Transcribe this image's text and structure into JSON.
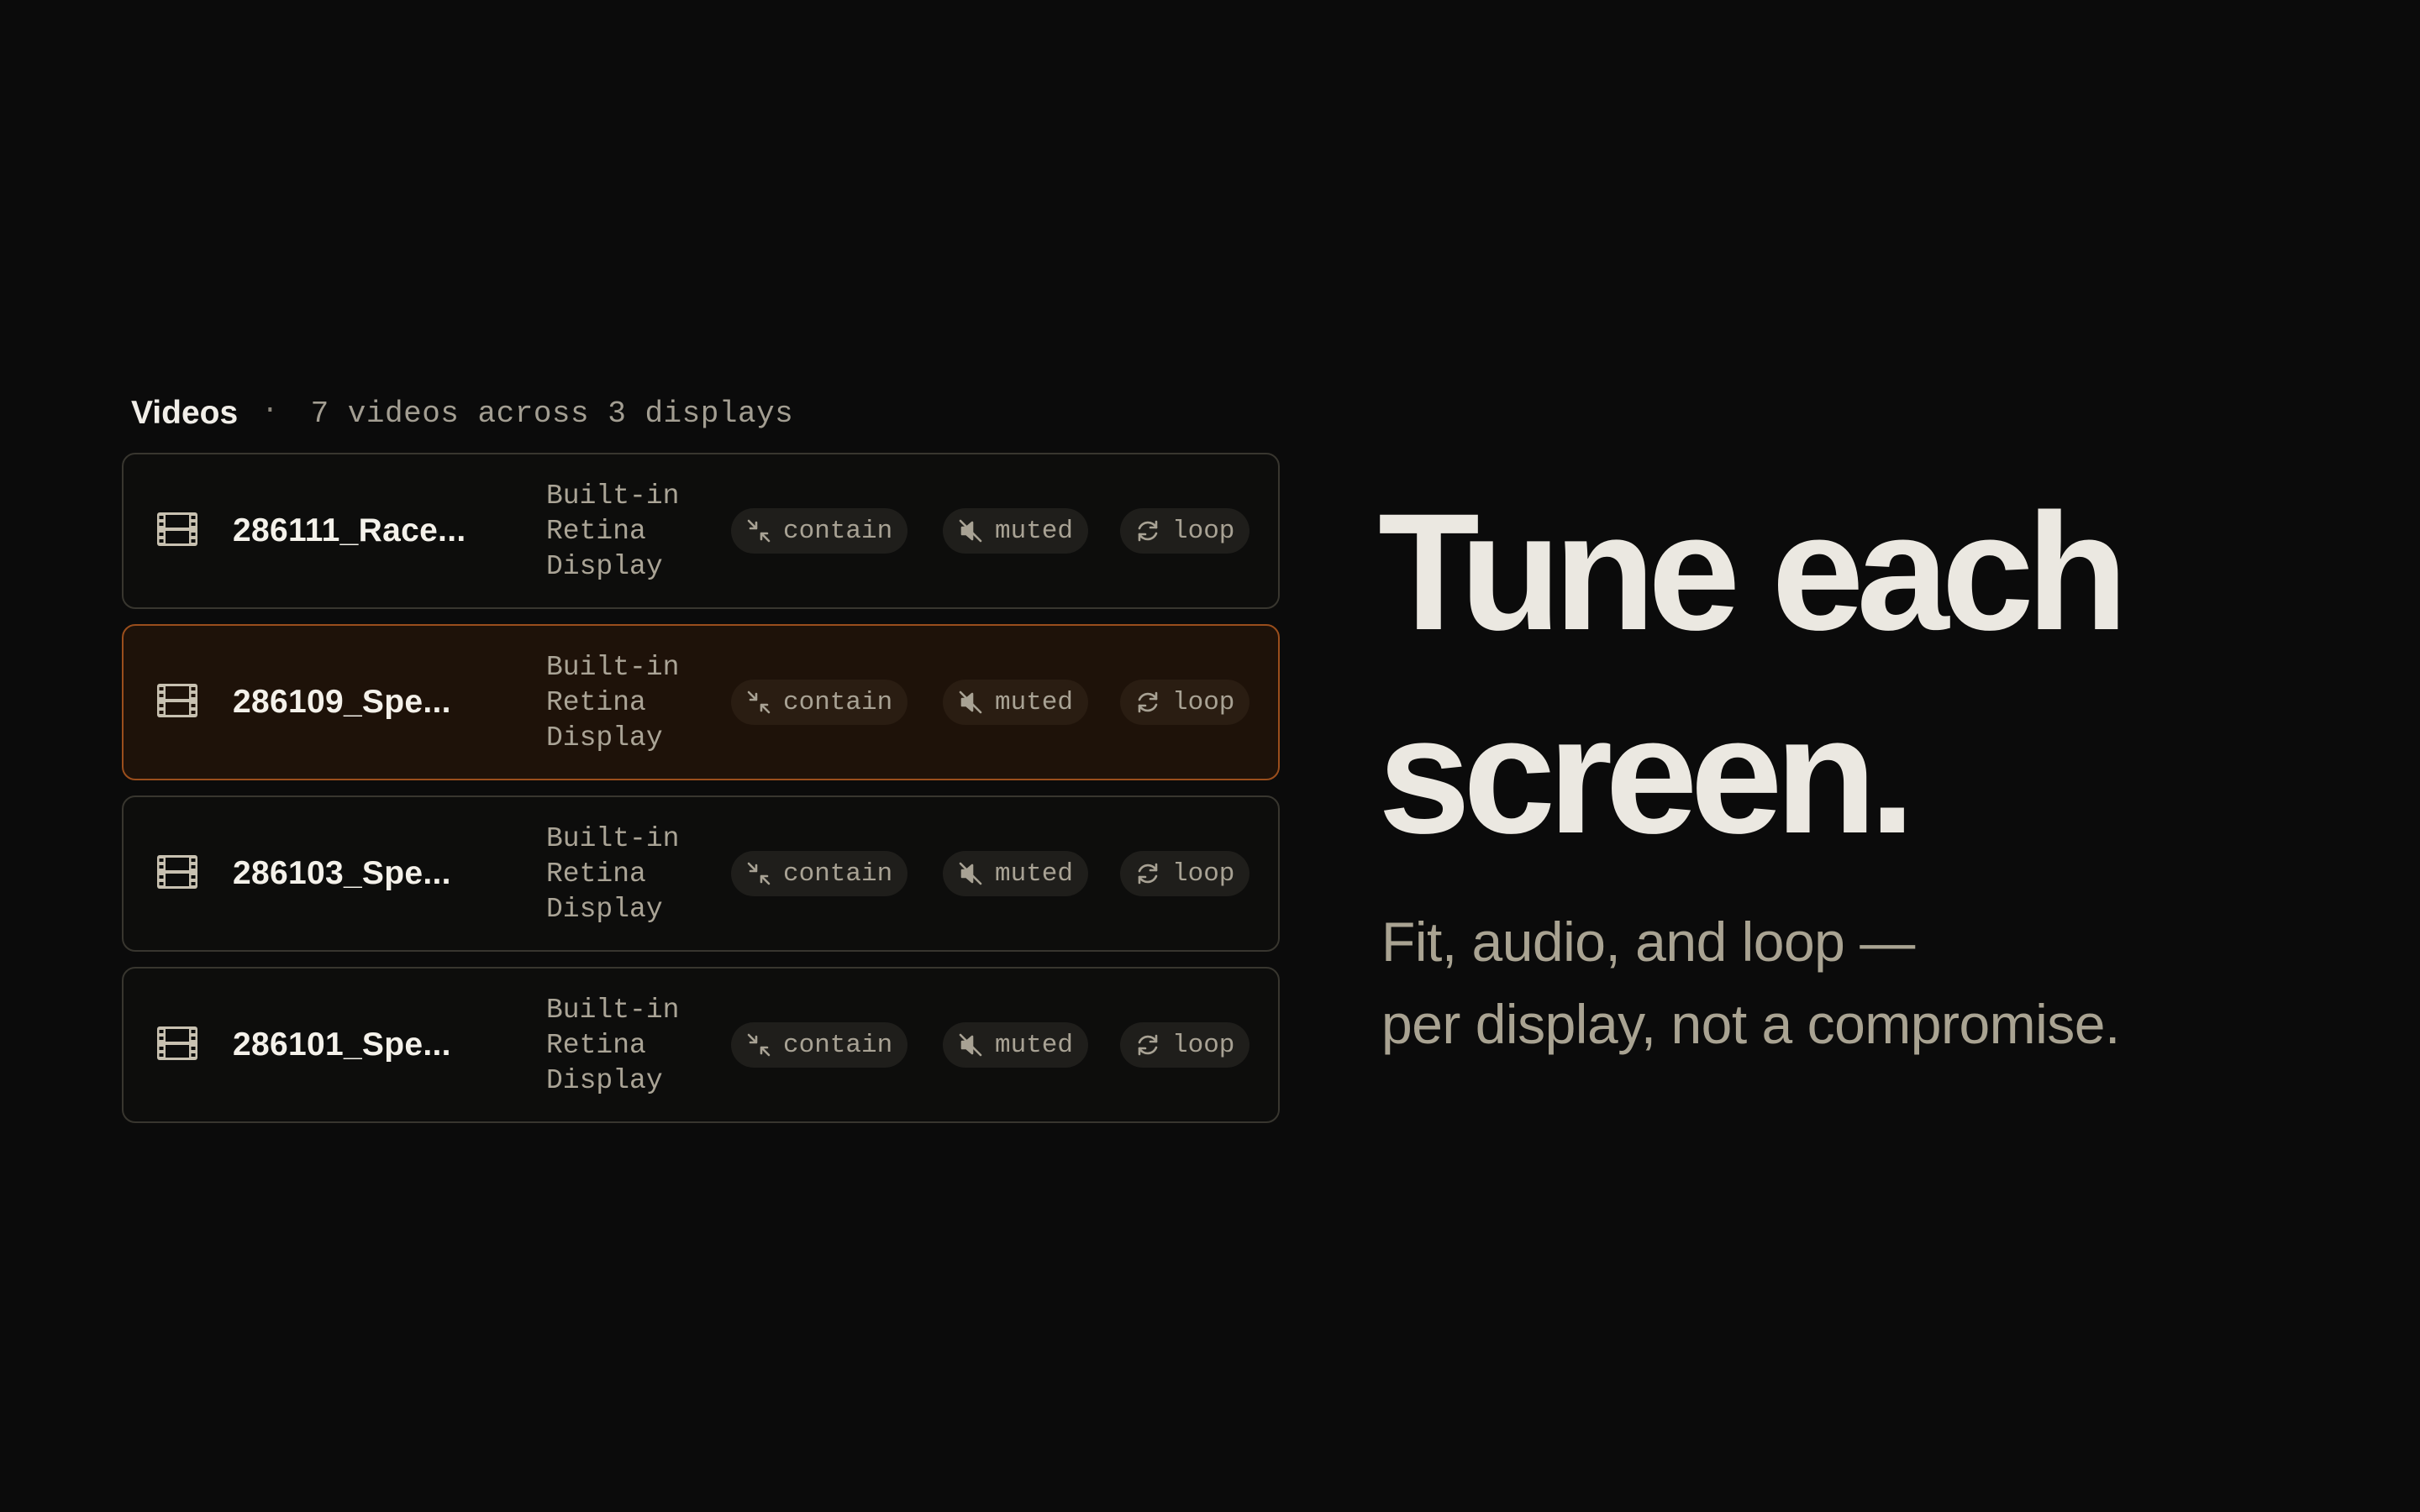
{
  "panel": {
    "title": "Videos",
    "separator": "·",
    "subtitle": "7 videos across 3 displays"
  },
  "videos": [
    {
      "name": "286111_Race...",
      "display_lines": [
        "Built-in",
        "Retina",
        "Display"
      ],
      "fit": "contain",
      "audio": "muted",
      "playback": "loop",
      "selected": false
    },
    {
      "name": "286109_Spe...",
      "display_lines": [
        "Built-in",
        "Retina",
        "Display"
      ],
      "fit": "contain",
      "audio": "muted",
      "playback": "loop",
      "selected": true
    },
    {
      "name": "286103_Spe...",
      "display_lines": [
        "Built-in",
        "Retina",
        "Display"
      ],
      "fit": "contain",
      "audio": "muted",
      "playback": "loop",
      "selected": false
    },
    {
      "name": "286101_Spe...",
      "display_lines": [
        "Built-in",
        "Retina",
        "Display"
      ],
      "fit": "contain",
      "audio": "muted",
      "playback": "loop",
      "selected": false
    }
  ],
  "icons": {
    "video": "film-icon",
    "fit": "contain-arrows-icon",
    "audio": "speaker-muted-icon",
    "playback": "loop-arrows-icon"
  },
  "hero": {
    "lines": [
      "Tune each",
      "screen."
    ]
  },
  "tagline": {
    "lines": [
      "Fit, audio, and loop —",
      "per display, not a compromise."
    ]
  },
  "colors": {
    "background": "#0b0b0b",
    "selected_border": "#9a4e1c",
    "selected_fill": "#1e1209",
    "headline": "#ebe8e1",
    "tagline": "#a9a392"
  }
}
